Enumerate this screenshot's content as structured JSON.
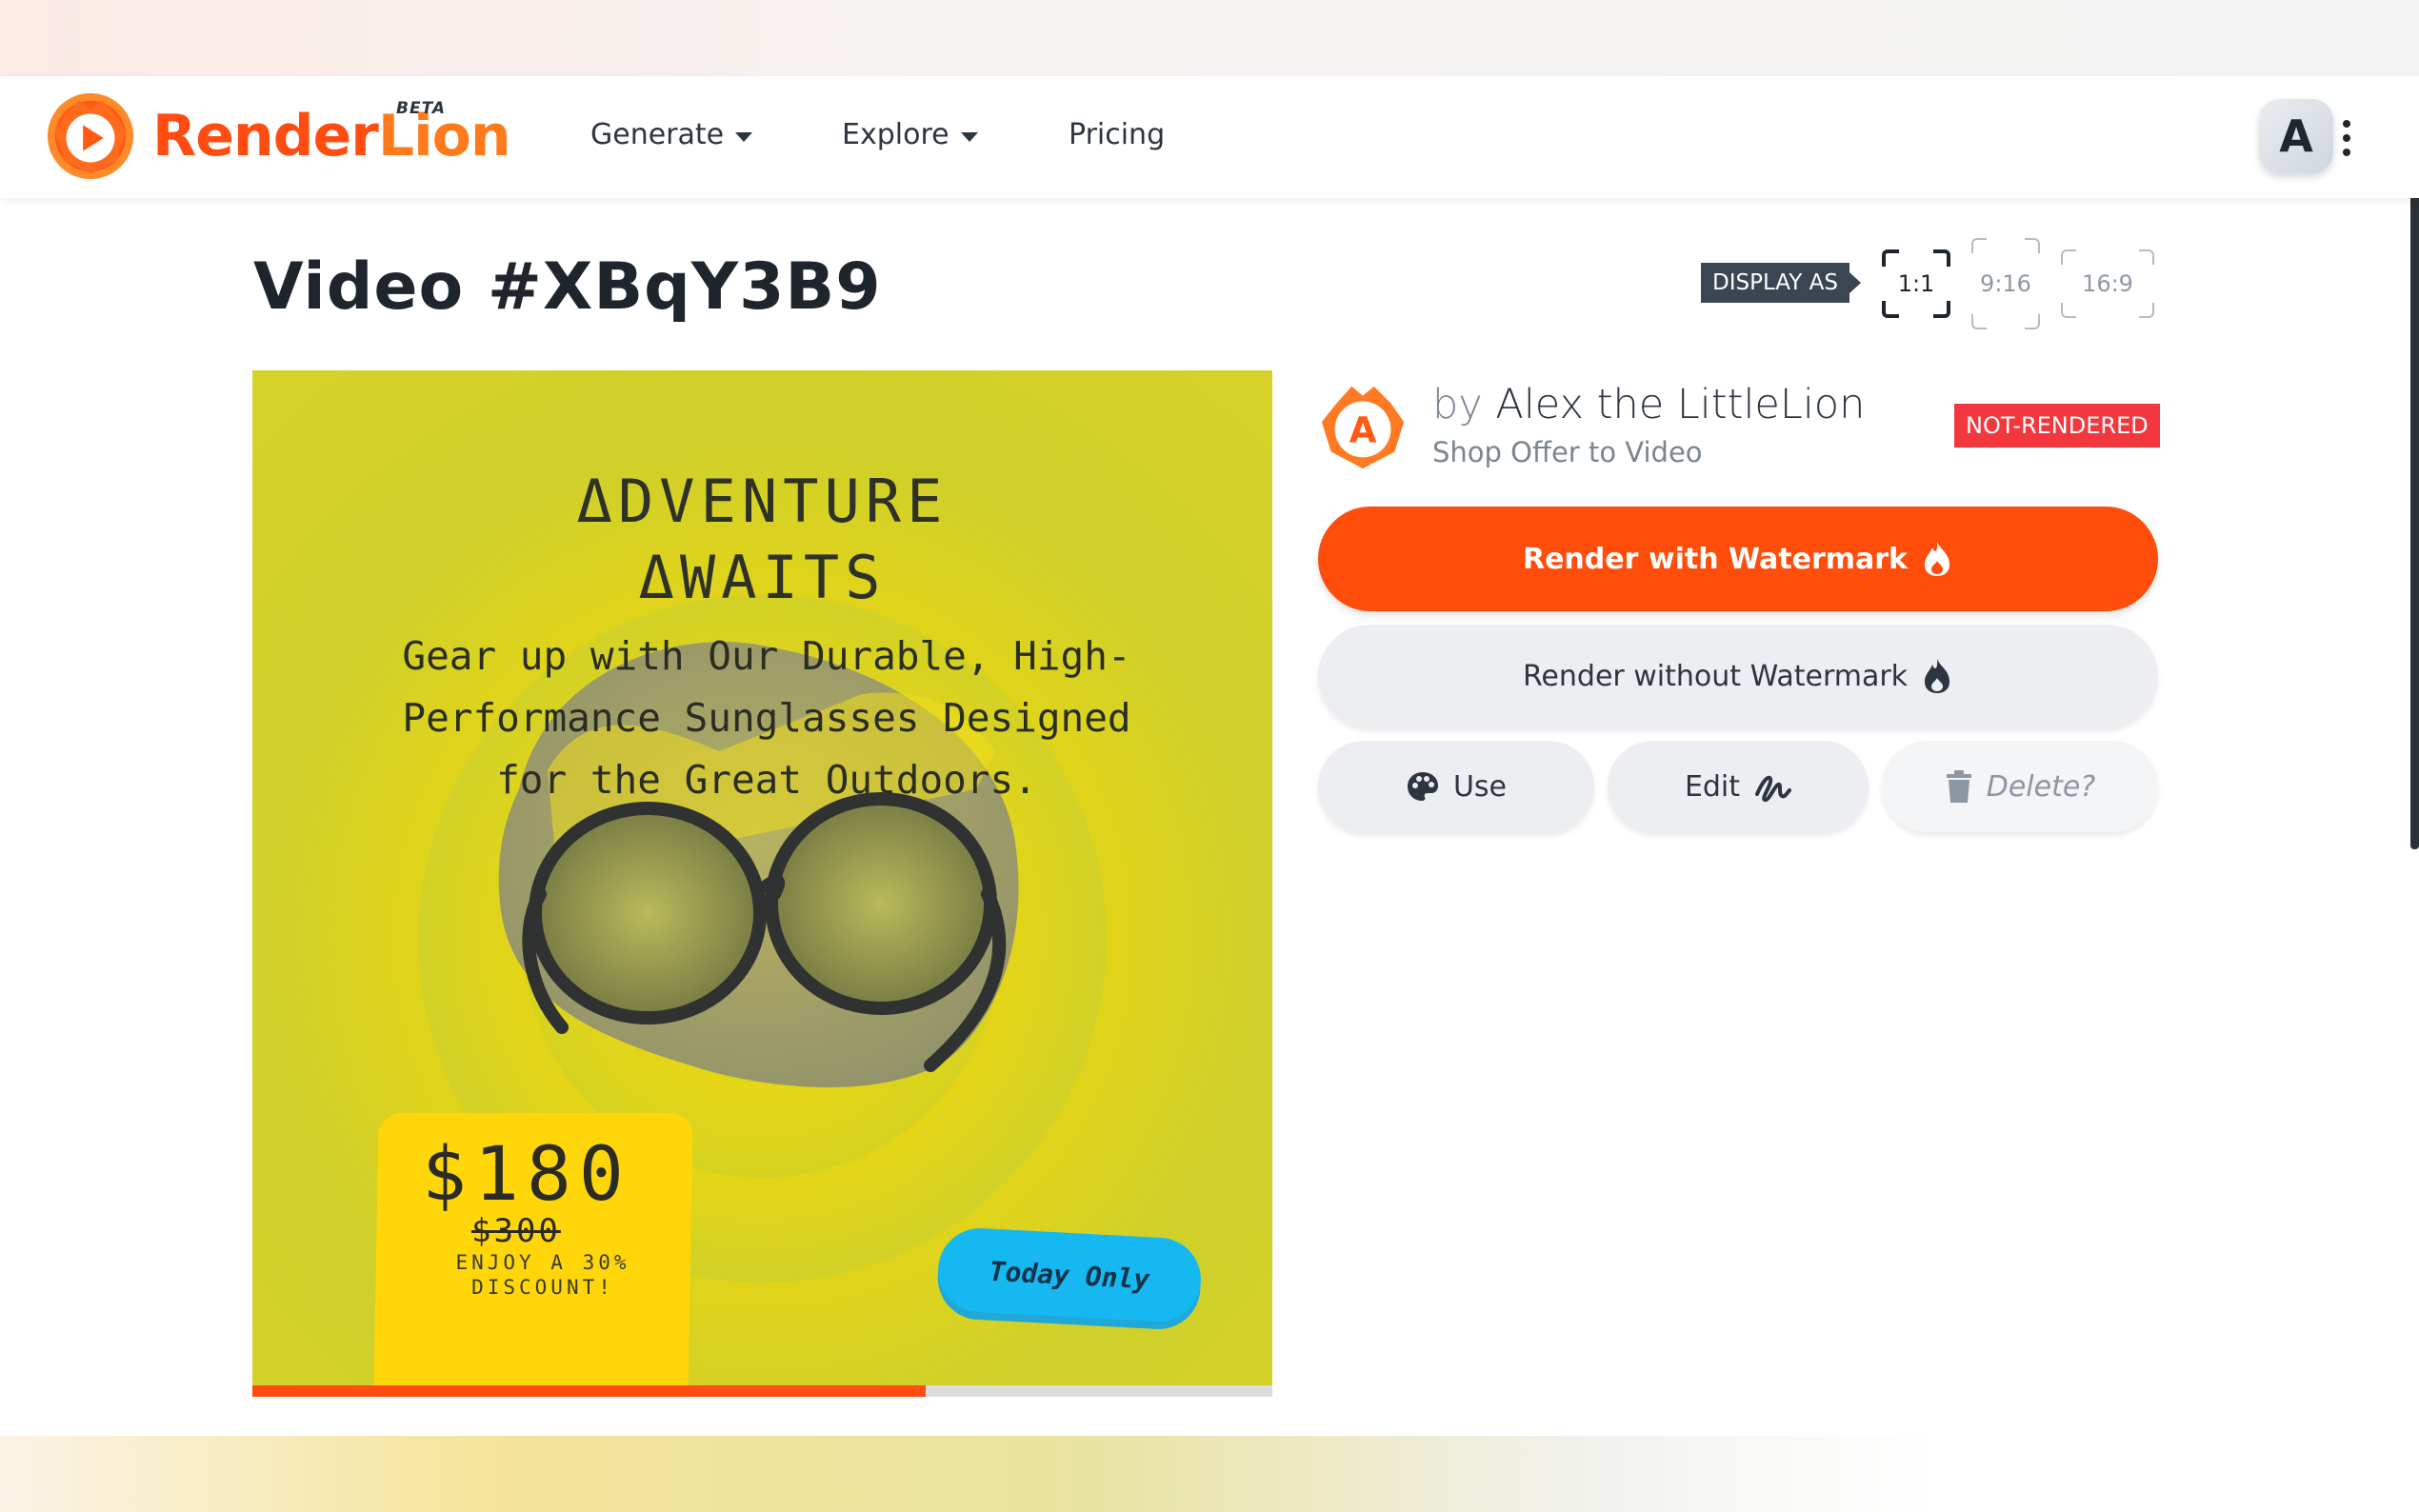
{
  "app": {
    "logo_text_1": "Render",
    "logo_text_2": "Lion",
    "beta_label": "BETA",
    "brand_color": "#ff4d12"
  },
  "nav": {
    "items": [
      {
        "label": "Generate",
        "has_dropdown": true
      },
      {
        "label": "Explore",
        "has_dropdown": true
      },
      {
        "label": "Pricing",
        "has_dropdown": false
      }
    ],
    "user_initial": "A",
    "menu_icon": "kebab-menu-icon"
  },
  "page": {
    "title": "Video #XBqY3B9",
    "display_as_label": "DISPLAY AS",
    "ratios": [
      {
        "label": "1:1",
        "selected": true
      },
      {
        "label": "9:16",
        "selected": false
      },
      {
        "label": "16:9",
        "selected": false
      }
    ]
  },
  "video": {
    "headline_line1": "ΔDVENTURE",
    "headline_line2": "ΔWAITS",
    "subtext": "Gear up with Our Durable, High-Performance Sunglasses Designed for the Great Outdoors.",
    "price": "$180",
    "old_price": "$300",
    "discount_line1": "ENJOY A 30%",
    "discount_line2": "DISCOUNT!",
    "badge": "Today Only",
    "progress": 0.66,
    "bg_color": "#d6d22a",
    "accent_yellow": "#ffd600",
    "badge_color": "#15b8f0"
  },
  "author": {
    "by_prefix": "by",
    "name": "Alex the LittleLion",
    "template": "Shop Offer to Video",
    "avatar_initial": "A",
    "status": "NOT-RENDERED",
    "status_color": "#f2373f"
  },
  "actions": {
    "render_watermark": "Render with Watermark",
    "render_no_watermark": "Render without Watermark",
    "use": "Use",
    "edit": "Edit",
    "delete": "Delete?",
    "primary_color": "#ff4e0c"
  }
}
